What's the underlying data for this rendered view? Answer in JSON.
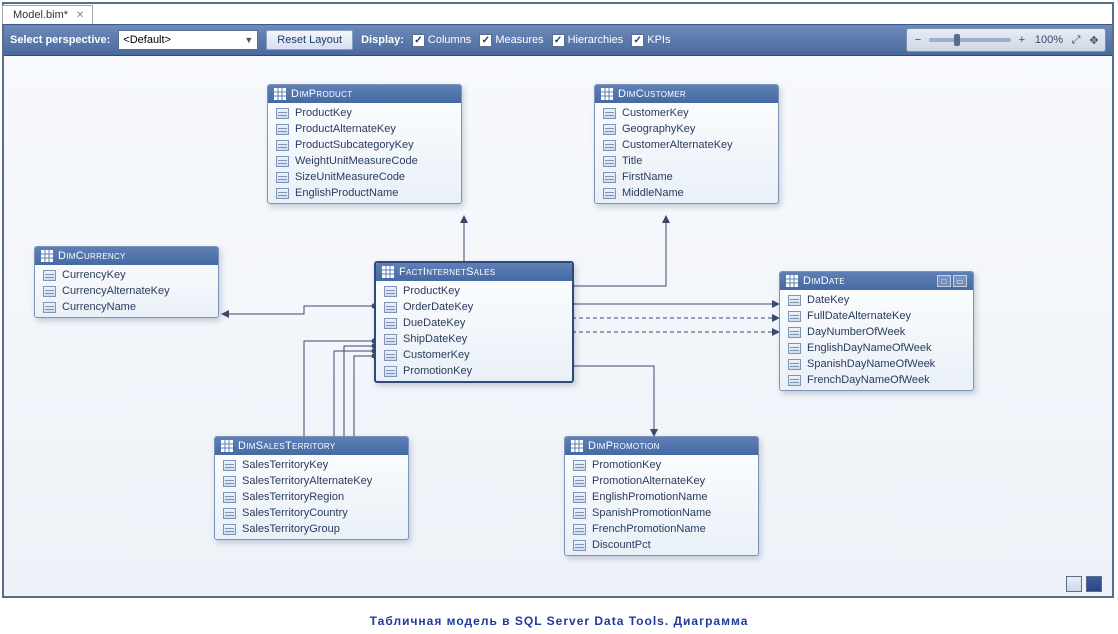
{
  "tab": {
    "title": "Model.bim*"
  },
  "toolbar": {
    "perspective_label": "Select perspective:",
    "perspective_value": "<Default>",
    "reset_layout": "Reset Layout",
    "display_label": "Display:",
    "checks": [
      {
        "label": "Columns"
      },
      {
        "label": "Measures"
      },
      {
        "label": "Hierarchies"
      },
      {
        "label": "KPIs"
      }
    ],
    "zoom_pct": "100%"
  },
  "entities": {
    "dimProduct": {
      "title": "DimProduct",
      "columns": [
        "ProductKey",
        "ProductAlternateKey",
        "ProductSubcategoryKey",
        "WeightUnitMeasureCode",
        "SizeUnitMeasureCode",
        "EnglishProductName"
      ]
    },
    "dimCustomer": {
      "title": "DimCustomer",
      "columns": [
        "CustomerKey",
        "GeographyKey",
        "CustomerAlternateKey",
        "Title",
        "FirstName",
        "MiddleName"
      ]
    },
    "dimCurrency": {
      "title": "DimCurrency",
      "columns": [
        "CurrencyKey",
        "CurrencyAlternateKey",
        "CurrencyName"
      ]
    },
    "fact": {
      "title": "FactInternetSales",
      "columns": [
        "ProductKey",
        "OrderDateKey",
        "DueDateKey",
        "ShipDateKey",
        "CustomerKey",
        "PromotionKey"
      ]
    },
    "dimDate": {
      "title": "DimDate",
      "columns": [
        "DateKey",
        "FullDateAlternateKey",
        "DayNumberOfWeek",
        "EnglishDayNameOfWeek",
        "SpanishDayNameOfWeek",
        "FrenchDayNameOfWeek"
      ]
    },
    "dimSalesTerritory": {
      "title": "DimSalesTerritory",
      "columns": [
        "SalesTerritoryKey",
        "SalesTerritoryAlternateKey",
        "SalesTerritoryRegion",
        "SalesTerritoryCountry",
        "SalesTerritoryGroup"
      ]
    },
    "dimPromotion": {
      "title": "DimPromotion",
      "columns": [
        "PromotionKey",
        "PromotionAlternateKey",
        "EnglishPromotionName",
        "SpanishPromotionName",
        "FrenchPromotionName",
        "DiscountPct"
      ]
    }
  },
  "caption": "Табличная модель в SQL Server Data Tools. Диаграмма"
}
